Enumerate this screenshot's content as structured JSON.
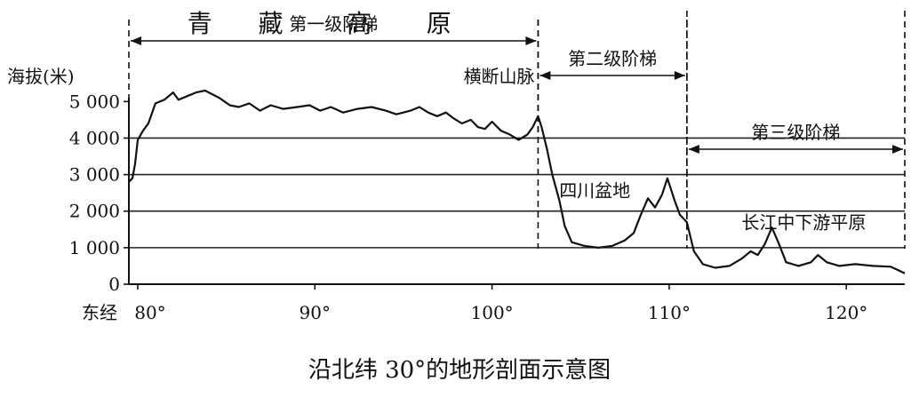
{
  "chart_data": {
    "type": "area",
    "caption": "沿北纬 30°的地形剖面示意图",
    "ylabel": "海拔(米)",
    "x_origin_label": "东经",
    "xlim": [
      79.5,
      123.3
    ],
    "ylim": [
      0,
      5300
    ],
    "xticks": [
      {
        "value": 80,
        "label": "80°"
      },
      {
        "value": 90,
        "label": "90°"
      },
      {
        "value": 100,
        "label": "100°"
      },
      {
        "value": 110,
        "label": "110°"
      },
      {
        "value": 120,
        "label": "120°"
      }
    ],
    "yticks": [
      {
        "value": 0,
        "label": "0"
      },
      {
        "value": 1000,
        "label": "1 000"
      },
      {
        "value": 2000,
        "label": "2 000"
      },
      {
        "value": 3000,
        "label": "3 000"
      },
      {
        "value": 4000,
        "label": "4 000"
      },
      {
        "value": 5000,
        "label": "5 000"
      }
    ],
    "grid_levels": [
      1000,
      2000,
      3000,
      4000
    ],
    "steps": [
      {
        "label": "第一级阶梯",
        "from": 79.5,
        "to": 102.6,
        "level": "top"
      },
      {
        "label": "第二级阶梯",
        "from": 102.6,
        "to": 111.0,
        "level": "middle"
      },
      {
        "label": "第三级阶梯",
        "from": 111.0,
        "to": 123.3,
        "level": "low"
      }
    ],
    "annotations": [
      {
        "text": "青",
        "x": 83.5,
        "y": 6900,
        "size": "large"
      },
      {
        "text": "藏",
        "x": 87.5,
        "y": 6900,
        "size": "large"
      },
      {
        "text": "高",
        "x": 92.5,
        "y": 6900,
        "size": "large"
      },
      {
        "text": "原",
        "x": 97.0,
        "y": 6900,
        "size": "large"
      },
      {
        "text": "横断山脉",
        "x": 100.4,
        "y": 5520,
        "size": "medium"
      },
      {
        "text": "四川盆地",
        "x": 105.8,
        "y": 2390,
        "size": "medium"
      },
      {
        "text": "长江中下游平原",
        "x": 117.6,
        "y": 1520,
        "size": "medium"
      }
    ],
    "profile": [
      [
        79.5,
        2800
      ],
      [
        79.7,
        2900
      ],
      [
        79.85,
        3300
      ],
      [
        80.0,
        3950
      ],
      [
        80.3,
        4200
      ],
      [
        80.6,
        4400
      ],
      [
        81.0,
        4950
      ],
      [
        81.5,
        5050
      ],
      [
        82.0,
        5250
      ],
      [
        82.3,
        5050
      ],
      [
        82.8,
        5150
      ],
      [
        83.3,
        5250
      ],
      [
        83.8,
        5300
      ],
      [
        84.2,
        5200
      ],
      [
        84.6,
        5100
      ],
      [
        85.2,
        4900
      ],
      [
        85.7,
        4850
      ],
      [
        86.3,
        4950
      ],
      [
        86.9,
        4750
      ],
      [
        87.5,
        4900
      ],
      [
        88.2,
        4800
      ],
      [
        89.0,
        4850
      ],
      [
        89.7,
        4900
      ],
      [
        90.3,
        4750
      ],
      [
        90.9,
        4850
      ],
      [
        91.6,
        4700
      ],
      [
        92.4,
        4800
      ],
      [
        93.2,
        4850
      ],
      [
        94.0,
        4750
      ],
      [
        94.6,
        4650
      ],
      [
        95.4,
        4750
      ],
      [
        95.9,
        4850
      ],
      [
        96.4,
        4700
      ],
      [
        96.9,
        4600
      ],
      [
        97.4,
        4700
      ],
      [
        97.8,
        4550
      ],
      [
        98.3,
        4400
      ],
      [
        98.8,
        4500
      ],
      [
        99.2,
        4300
      ],
      [
        99.6,
        4250
      ],
      [
        100.0,
        4450
      ],
      [
        100.5,
        4200
      ],
      [
        101.0,
        4100
      ],
      [
        101.5,
        3950
      ],
      [
        102.0,
        4100
      ],
      [
        102.3,
        4300
      ],
      [
        102.6,
        4600
      ],
      [
        102.8,
        4300
      ],
      [
        103.1,
        3700
      ],
      [
        103.4,
        3000
      ],
      [
        103.8,
        2300
      ],
      [
        104.1,
        1600
      ],
      [
        104.5,
        1150
      ],
      [
        105.2,
        1050
      ],
      [
        106.0,
        1000
      ],
      [
        106.8,
        1050
      ],
      [
        107.5,
        1200
      ],
      [
        108.0,
        1400
      ],
      [
        108.4,
        1900
      ],
      [
        108.8,
        2350
      ],
      [
        109.2,
        2100
      ],
      [
        109.6,
        2450
      ],
      [
        109.9,
        2900
      ],
      [
        110.3,
        2300
      ],
      [
        110.6,
        1900
      ],
      [
        111.0,
        1700
      ],
      [
        111.4,
        900
      ],
      [
        111.9,
        550
      ],
      [
        112.6,
        450
      ],
      [
        113.4,
        500
      ],
      [
        114.1,
        700
      ],
      [
        114.6,
        900
      ],
      [
        115.0,
        800
      ],
      [
        115.4,
        1100
      ],
      [
        115.8,
        1550
      ],
      [
        116.2,
        1100
      ],
      [
        116.6,
        600
      ],
      [
        117.3,
        500
      ],
      [
        118.0,
        600
      ],
      [
        118.4,
        800
      ],
      [
        118.9,
        600
      ],
      [
        119.6,
        500
      ],
      [
        120.5,
        550
      ],
      [
        121.5,
        500
      ],
      [
        122.5,
        480
      ],
      [
        123.3,
        300
      ]
    ]
  }
}
